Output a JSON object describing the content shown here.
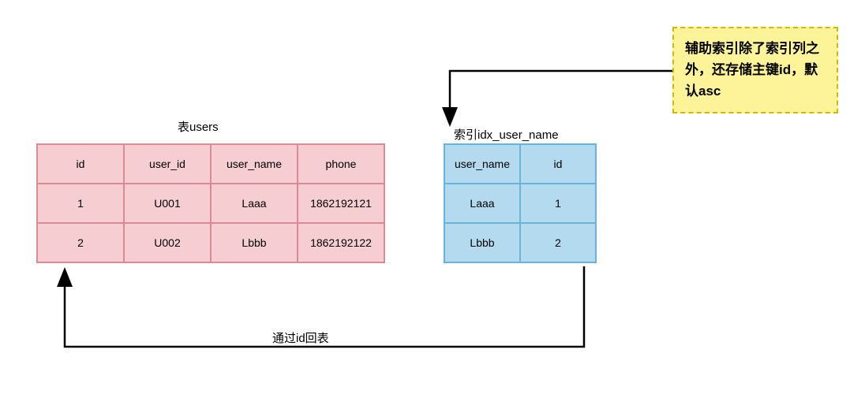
{
  "users_table": {
    "title": "表users",
    "headers": [
      "id",
      "user_id",
      "user_name",
      "phone"
    ],
    "rows": [
      [
        "1",
        "U001",
        "Laaa",
        "1862192121"
      ],
      [
        "2",
        "U002",
        "Lbbb",
        "1862192122"
      ]
    ]
  },
  "index_table": {
    "title": "索引idx_user_name",
    "headers": [
      "user_name",
      "id"
    ],
    "rows": [
      [
        "Laaa",
        "1"
      ],
      [
        "Lbbb",
        "2"
      ]
    ]
  },
  "callout_text": "辅助索引除了索引列之外，还存储主键id，默认asc",
  "bottom_arrow_label": "通过id回表"
}
